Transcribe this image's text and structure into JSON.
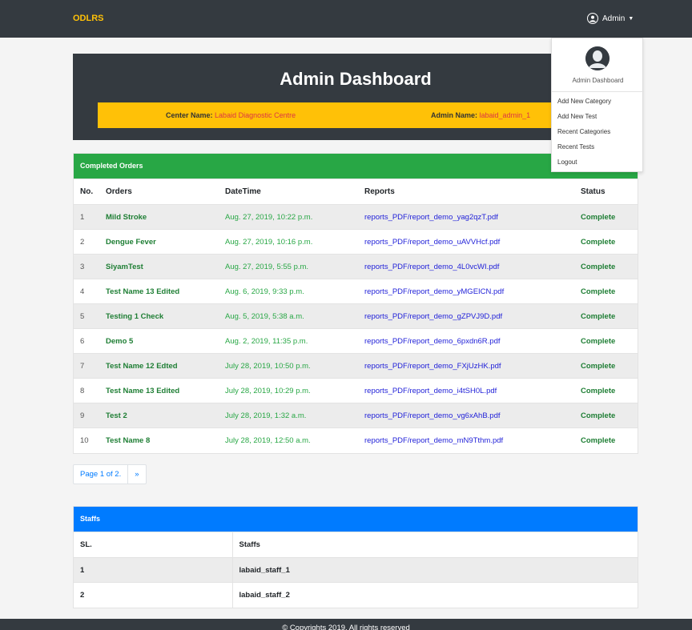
{
  "nav": {
    "brand": "ODLRS",
    "user_label": "Admin"
  },
  "dropdown": {
    "title": "Admin Dashboard",
    "items": [
      "Add New Category",
      "Add New Test",
      "Recent Categories",
      "Recent Tests",
      "Logout"
    ]
  },
  "header": {
    "title": "Admin Dashboard",
    "center_label": "Center Name:",
    "center_value": "Labaid Diagnostic Centre",
    "admin_label": "Admin Name:",
    "admin_value": "labaid_admin_1"
  },
  "orders": {
    "heading": "Completed Orders",
    "columns": [
      "No.",
      "Orders",
      "DateTime",
      "Reports",
      "Status"
    ],
    "rows": [
      {
        "no": "1",
        "order": "Mild Stroke",
        "datetime": "Aug. 27, 2019, 10:22 p.m.",
        "report": "reports_PDF/report_demo_yag2qzT.pdf",
        "status": "Complete"
      },
      {
        "no": "2",
        "order": "Dengue Fever",
        "datetime": "Aug. 27, 2019, 10:16 p.m.",
        "report": "reports_PDF/report_demo_uAVVHcf.pdf",
        "status": "Complete"
      },
      {
        "no": "3",
        "order": "SiyamTest",
        "datetime": "Aug. 27, 2019, 5:55 p.m.",
        "report": "reports_PDF/report_demo_4L0vcWI.pdf",
        "status": "Complete"
      },
      {
        "no": "4",
        "order": "Test Name 13 Edited",
        "datetime": "Aug. 6, 2019, 9:33 p.m.",
        "report": "reports_PDF/report_demo_yMGEICN.pdf",
        "status": "Complete"
      },
      {
        "no": "5",
        "order": "Testing 1 Check",
        "datetime": "Aug. 5, 2019, 5:38 a.m.",
        "report": "reports_PDF/report_demo_gZPVJ9D.pdf",
        "status": "Complete"
      },
      {
        "no": "6",
        "order": "Demo 5",
        "datetime": "Aug. 2, 2019, 11:35 p.m.",
        "report": "reports_PDF/report_demo_6pxdn6R.pdf",
        "status": "Complete"
      },
      {
        "no": "7",
        "order": "Test Name 12 Edted",
        "datetime": "July 28, 2019, 10:50 p.m.",
        "report": "reports_PDF/report_demo_FXjUzHK.pdf",
        "status": "Complete"
      },
      {
        "no": "8",
        "order": "Test Name 13 Edited",
        "datetime": "July 28, 2019, 10:29 p.m.",
        "report": "reports_PDF/report_demo_i4tSH0L.pdf",
        "status": "Complete"
      },
      {
        "no": "9",
        "order": "Test 2",
        "datetime": "July 28, 2019, 1:32 a.m.",
        "report": "reports_PDF/report_demo_vg6xAhB.pdf",
        "status": "Complete"
      },
      {
        "no": "10",
        "order": "Test Name 8",
        "datetime": "July 28, 2019, 12:50 a.m.",
        "report": "reports_PDF/report_demo_mN9Tthm.pdf",
        "status": "Complete"
      }
    ]
  },
  "pagination": {
    "page_label": "Page 1 of 2.",
    "next": "»"
  },
  "staffs": {
    "heading": "Staffs",
    "columns": [
      "SL.",
      "Staffs"
    ],
    "rows": [
      {
        "sl": "1",
        "name": "labaid_staff_1"
      },
      {
        "sl": "2",
        "name": "labaid_staff_2"
      }
    ]
  },
  "footer": {
    "text": "© Copyrights 2019. All rights reserved"
  }
}
